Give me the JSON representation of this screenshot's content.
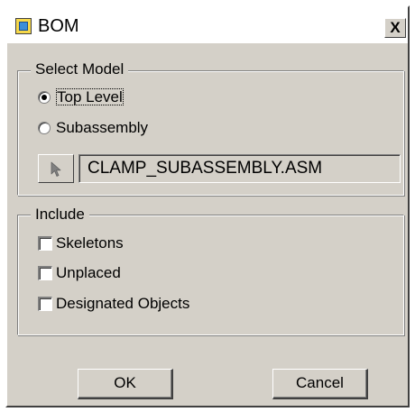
{
  "window": {
    "title": "BOM",
    "close_label": "X",
    "icon": "bom-window-icon"
  },
  "select_model": {
    "legend": "Select Model",
    "options": [
      {
        "label": "Top Level",
        "selected": true
      },
      {
        "label": "Subassembly",
        "selected": false
      }
    ],
    "pick_button_icon": "arrow-pointer-icon",
    "model_value": "CLAMP_SUBASSEMBLY.ASM"
  },
  "include": {
    "legend": "Include",
    "options": [
      {
        "label": "Skeletons",
        "checked": false
      },
      {
        "label": "Unplaced",
        "checked": false
      },
      {
        "label": "Designated Objects",
        "checked": false
      }
    ]
  },
  "buttons": {
    "ok": "OK",
    "cancel": "Cancel"
  },
  "colors": {
    "dialog_background": "#d4d0c8",
    "title_background": "#ffffff",
    "icon_yellow": "#f6d84a",
    "icon_blue": "#3b8ed8"
  }
}
